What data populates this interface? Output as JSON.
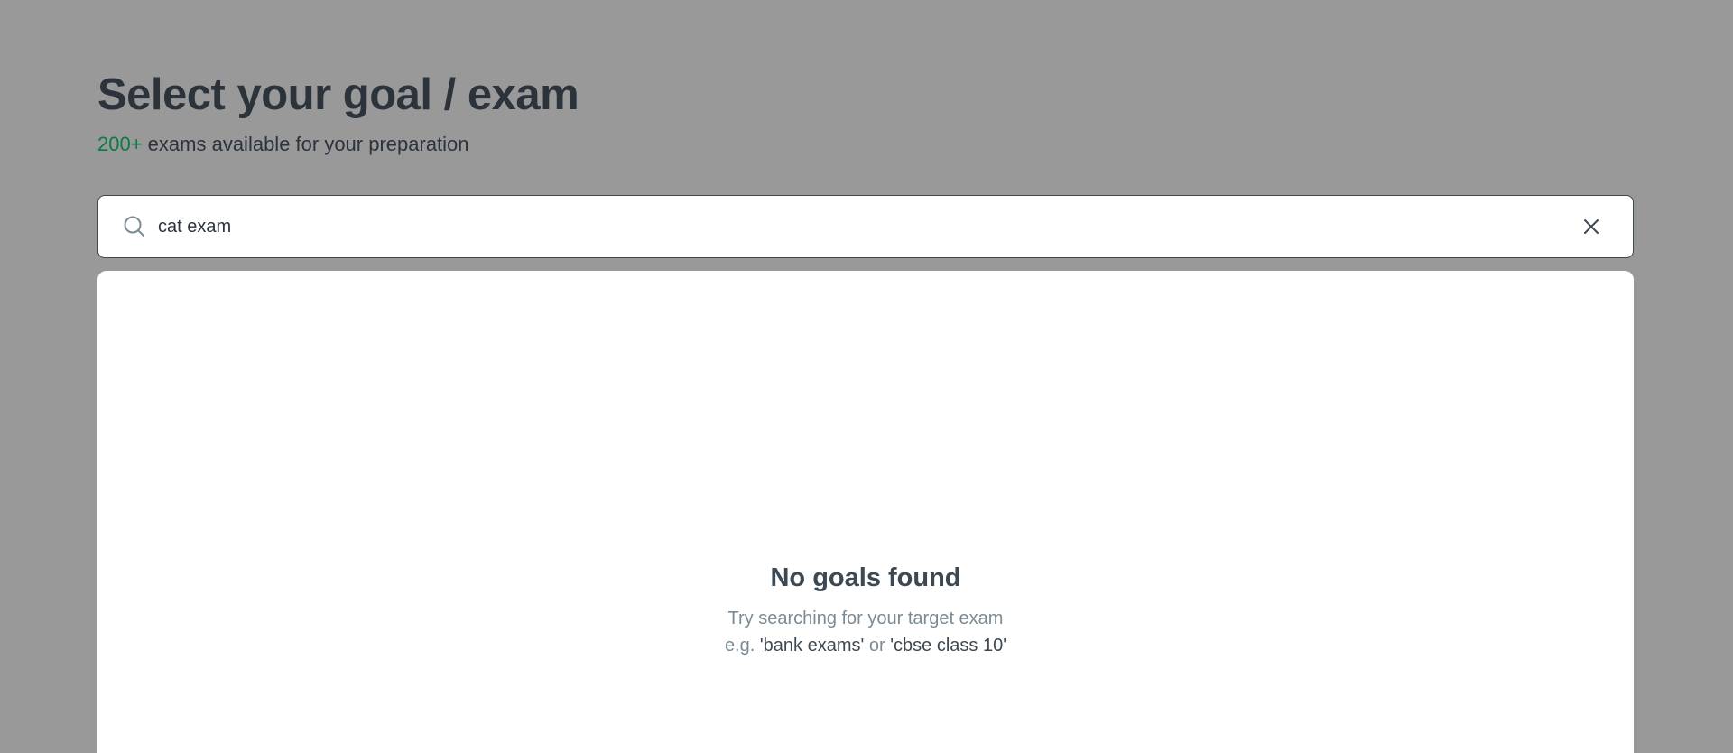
{
  "header": {
    "title": "Select your goal / exam",
    "subtitle_highlight": "200+",
    "subtitle_rest": " exams available for your preparation"
  },
  "search": {
    "icon": "search-icon",
    "value": "cat exam",
    "placeholder": "",
    "clear_icon": "close-icon"
  },
  "results": {
    "empty_title": "No goals found",
    "hint_line1": "Try searching for your target exam",
    "hint_prefix": "e.g. ",
    "example1": "'bank exams'",
    "hint_or": " or ",
    "example2": "'cbse class 10'"
  },
  "colors": {
    "overlay_background": "#999999",
    "accent_green": "#0b7a43",
    "text_dark": "#2c333b",
    "text_muted": "#7a8b94"
  }
}
